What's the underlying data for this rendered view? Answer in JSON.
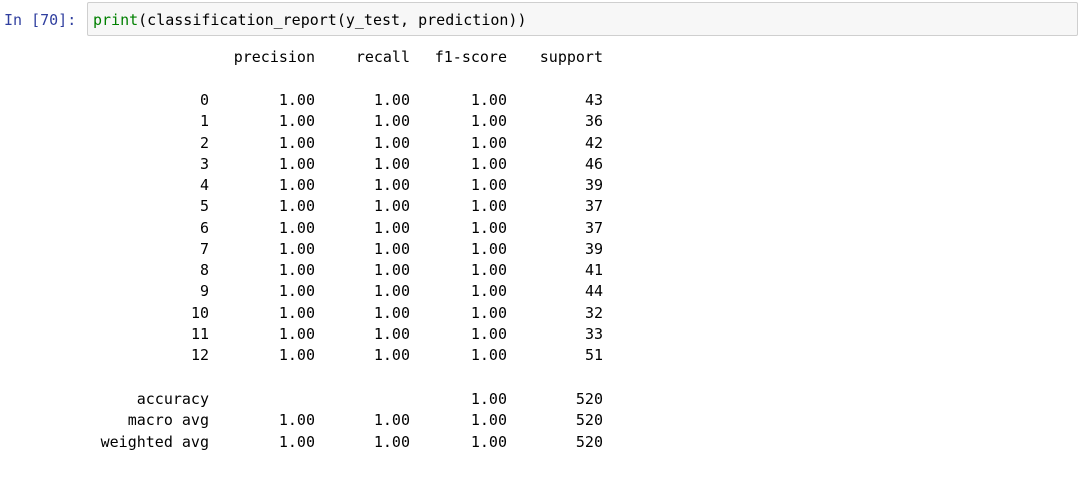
{
  "cell": {
    "prompt": "In [70]:",
    "code_func": "print",
    "code_rest": "(classification_report(y_test, prediction))"
  },
  "report": {
    "headers": [
      "precision",
      "recall",
      "f1-score",
      "support"
    ],
    "rows": [
      {
        "label": "0",
        "precision": "1.00",
        "recall": "1.00",
        "f1": "1.00",
        "support": "43"
      },
      {
        "label": "1",
        "precision": "1.00",
        "recall": "1.00",
        "f1": "1.00",
        "support": "36"
      },
      {
        "label": "2",
        "precision": "1.00",
        "recall": "1.00",
        "f1": "1.00",
        "support": "42"
      },
      {
        "label": "3",
        "precision": "1.00",
        "recall": "1.00",
        "f1": "1.00",
        "support": "46"
      },
      {
        "label": "4",
        "precision": "1.00",
        "recall": "1.00",
        "f1": "1.00",
        "support": "39"
      },
      {
        "label": "5",
        "precision": "1.00",
        "recall": "1.00",
        "f1": "1.00",
        "support": "37"
      },
      {
        "label": "6",
        "precision": "1.00",
        "recall": "1.00",
        "f1": "1.00",
        "support": "37"
      },
      {
        "label": "7",
        "precision": "1.00",
        "recall": "1.00",
        "f1": "1.00",
        "support": "39"
      },
      {
        "label": "8",
        "precision": "1.00",
        "recall": "1.00",
        "f1": "1.00",
        "support": "41"
      },
      {
        "label": "9",
        "precision": "1.00",
        "recall": "1.00",
        "f1": "1.00",
        "support": "44"
      },
      {
        "label": "10",
        "precision": "1.00",
        "recall": "1.00",
        "f1": "1.00",
        "support": "32"
      },
      {
        "label": "11",
        "precision": "1.00",
        "recall": "1.00",
        "f1": "1.00",
        "support": "33"
      },
      {
        "label": "12",
        "precision": "1.00",
        "recall": "1.00",
        "f1": "1.00",
        "support": "51"
      }
    ],
    "summary": [
      {
        "label": "accuracy",
        "precision": "",
        "recall": "",
        "f1": "1.00",
        "support": "520"
      },
      {
        "label": "macro avg",
        "precision": "1.00",
        "recall": "1.00",
        "f1": "1.00",
        "support": "520"
      },
      {
        "label": "weighted avg",
        "precision": "1.00",
        "recall": "1.00",
        "f1": "1.00",
        "support": "520"
      }
    ]
  },
  "colors": {
    "prompt": "#303f9f",
    "builtin": "#008000",
    "input_bg": "#f7f7f7",
    "input_border": "#cfcfcf"
  }
}
